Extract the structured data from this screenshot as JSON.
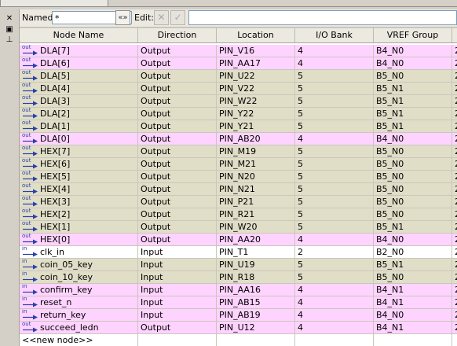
{
  "filter": {
    "named_label": "Named:",
    "named_value": "*",
    "assistant_glyph": "«»",
    "edit_label": "Edit:",
    "cancel_glyph": "✕",
    "accept_glyph": "✓",
    "edit_value": ""
  },
  "sidebar": {
    "close_glyph": "✕",
    "dock_glyph": "▣",
    "pin_glyph": "⊥"
  },
  "columns": [
    "Node Name",
    "Direction",
    "Location",
    "I/O Bank",
    "VREF Group"
  ],
  "rows": [
    {
      "badge": "out",
      "name": "DLA[7]",
      "direction": "Output",
      "location": "PIN_V16",
      "bank": "4",
      "vref": "B4_N0",
      "color": "pink",
      "extra": "2"
    },
    {
      "badge": "out",
      "name": "DLA[6]",
      "direction": "Output",
      "location": "PIN_AA17",
      "bank": "4",
      "vref": "B4_N0",
      "color": "pink",
      "extra": "2"
    },
    {
      "badge": "out",
      "name": "DLA[5]",
      "direction": "Output",
      "location": "PIN_U22",
      "bank": "5",
      "vref": "B5_N0",
      "color": "olive",
      "extra": "2"
    },
    {
      "badge": "out",
      "name": "DLA[4]",
      "direction": "Output",
      "location": "PIN_V22",
      "bank": "5",
      "vref": "B5_N1",
      "color": "olive",
      "extra": "2"
    },
    {
      "badge": "out",
      "name": "DLA[3]",
      "direction": "Output",
      "location": "PIN_W22",
      "bank": "5",
      "vref": "B5_N1",
      "color": "olive",
      "extra": "2"
    },
    {
      "badge": "out",
      "name": "DLA[2]",
      "direction": "Output",
      "location": "PIN_Y22",
      "bank": "5",
      "vref": "B5_N1",
      "color": "olive",
      "extra": "2"
    },
    {
      "badge": "out",
      "name": "DLA[1]",
      "direction": "Output",
      "location": "PIN_Y21",
      "bank": "5",
      "vref": "B5_N1",
      "color": "olive",
      "extra": "2"
    },
    {
      "badge": "out",
      "name": "DLA[0]",
      "direction": "Output",
      "location": "PIN_AB20",
      "bank": "4",
      "vref": "B4_N0",
      "color": "pink",
      "extra": "2"
    },
    {
      "badge": "out",
      "name": "HEX[7]",
      "direction": "Output",
      "location": "PIN_M19",
      "bank": "5",
      "vref": "B5_N0",
      "color": "olive",
      "extra": "2"
    },
    {
      "badge": "out",
      "name": "HEX[6]",
      "direction": "Output",
      "location": "PIN_M21",
      "bank": "5",
      "vref": "B5_N0",
      "color": "olive",
      "extra": "2"
    },
    {
      "badge": "out",
      "name": "HEX[5]",
      "direction": "Output",
      "location": "PIN_N20",
      "bank": "5",
      "vref": "B5_N0",
      "color": "olive",
      "extra": "2"
    },
    {
      "badge": "out",
      "name": "HEX[4]",
      "direction": "Output",
      "location": "PIN_N21",
      "bank": "5",
      "vref": "B5_N0",
      "color": "olive",
      "extra": "2"
    },
    {
      "badge": "out",
      "name": "HEX[3]",
      "direction": "Output",
      "location": "PIN_P21",
      "bank": "5",
      "vref": "B5_N0",
      "color": "olive",
      "extra": "2"
    },
    {
      "badge": "out",
      "name": "HEX[2]",
      "direction": "Output",
      "location": "PIN_R21",
      "bank": "5",
      "vref": "B5_N0",
      "color": "olive",
      "extra": "2"
    },
    {
      "badge": "out",
      "name": "HEX[1]",
      "direction": "Output",
      "location": "PIN_W20",
      "bank": "5",
      "vref": "B5_N1",
      "color": "olive",
      "extra": "2"
    },
    {
      "badge": "out",
      "name": "HEX[0]",
      "direction": "Output",
      "location": "PIN_AA20",
      "bank": "4",
      "vref": "B4_N0",
      "color": "pink",
      "extra": "2"
    },
    {
      "badge": "in",
      "name": "clk_in",
      "direction": "Input",
      "location": "PIN_T1",
      "bank": "2",
      "vref": "B2_N0",
      "color": "white",
      "extra": "2"
    },
    {
      "badge": "in",
      "name": "coin_05_key",
      "direction": "Input",
      "location": "PIN_U19",
      "bank": "5",
      "vref": "B5_N1",
      "color": "olive",
      "extra": "2"
    },
    {
      "badge": "in",
      "name": "coin_10_key",
      "direction": "Input",
      "location": "PIN_R18",
      "bank": "5",
      "vref": "B5_N0",
      "color": "olive",
      "extra": "2"
    },
    {
      "badge": "in",
      "name": "confirm_key",
      "direction": "Input",
      "location": "PIN_AA16",
      "bank": "4",
      "vref": "B4_N1",
      "color": "pink",
      "extra": "2"
    },
    {
      "badge": "in",
      "name": "reset_n",
      "direction": "Input",
      "location": "PIN_AB15",
      "bank": "4",
      "vref": "B4_N1",
      "color": "pink",
      "extra": "2"
    },
    {
      "badge": "in",
      "name": "return_key",
      "direction": "Input",
      "location": "PIN_AB19",
      "bank": "4",
      "vref": "B4_N0",
      "color": "pink",
      "extra": "2"
    },
    {
      "badge": "out",
      "name": "succeed_ledn",
      "direction": "Output",
      "location": "PIN_U12",
      "bank": "4",
      "vref": "B4_N1",
      "color": "pink",
      "extra": "2"
    }
  ],
  "new_node_label": "<<new node>>",
  "colors": {
    "output_row_pink": "#ffd3ff",
    "bank5_row": "#e1dec8",
    "badge_blue": "#2a3fa8"
  }
}
